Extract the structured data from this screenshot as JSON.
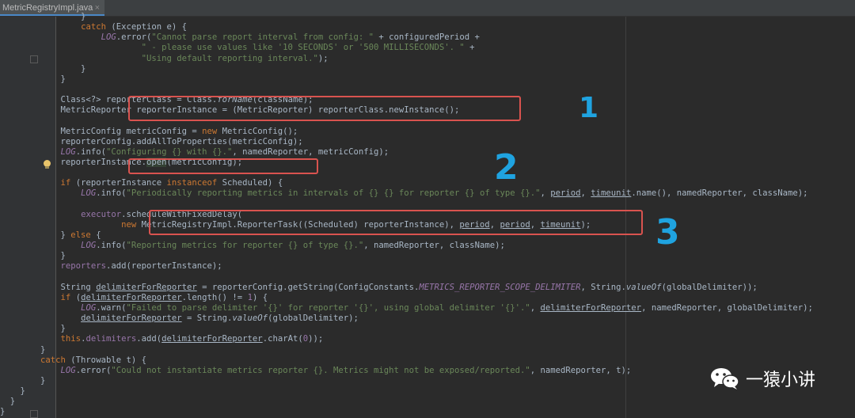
{
  "tab": {
    "filename": "MetricRegistryImpl.java",
    "close": "×"
  },
  "annotations": [
    "1",
    "2",
    "3"
  ],
  "watermark": {
    "text": "一猿小讲"
  },
  "colors": {
    "box": "#d9534f",
    "annotation": "#1fa3e0",
    "keyword": "#cc7832",
    "string": "#6a8759",
    "field": "#9876aa"
  },
  "code": [
    [
      [
        "                }",
        ""
      ]
    ],
    [
      [
        "                ",
        ""
      ],
      [
        "catch",
        "kw"
      ],
      [
        " (Exception e) {",
        ""
      ]
    ],
    [
      [
        "                    ",
        ""
      ],
      [
        "LOG",
        "log"
      ],
      [
        ".error(",
        ""
      ],
      [
        "\"Cannot parse report interval from config: \"",
        "str"
      ],
      [
        " + configuredPeriod +",
        ""
      ]
    ],
    [
      [
        "                            ",
        ""
      ],
      [
        "\" - please use values like '10 SECONDS' or '500 MILLISECONDS'. \"",
        "str"
      ],
      [
        " +",
        ""
      ]
    ],
    [
      [
        "                            ",
        ""
      ],
      [
        "\"Using default reporting interval.\"",
        "str"
      ],
      [
        ");",
        ""
      ]
    ],
    [
      [
        "                }",
        ""
      ]
    ],
    [
      [
        "            }",
        ""
      ]
    ],
    [
      [
        "",
        ""
      ]
    ],
    [
      [
        "            Class<?> reporterClass = Class.",
        ""
      ],
      [
        "forName",
        "itl"
      ],
      [
        "(className);",
        ""
      ]
    ],
    [
      [
        "            MetricReporter reporterInstance = (MetricReporter) reporterClass.newInstance();",
        ""
      ]
    ],
    [
      [
        "",
        ""
      ]
    ],
    [
      [
        "            MetricConfig metricConfig = ",
        ""
      ],
      [
        "new",
        "kw"
      ],
      [
        " MetricConfig();",
        ""
      ]
    ],
    [
      [
        "            reporterConfig.addAllToProperties(metricConfig);",
        ""
      ]
    ],
    [
      [
        "            ",
        ""
      ],
      [
        "LOG",
        "log"
      ],
      [
        ".info(",
        ""
      ],
      [
        "\"Configuring {} with {}.\"",
        "str"
      ],
      [
        ", namedReporter, metricConfig);",
        ""
      ]
    ],
    [
      [
        "            reporterInstance.",
        ""
      ],
      [
        "open",
        "hl"
      ],
      [
        "(metricConfig);",
        ""
      ]
    ],
    [
      [
        "",
        ""
      ]
    ],
    [
      [
        "            ",
        ""
      ],
      [
        "if",
        "kw"
      ],
      [
        " (reporterInstance ",
        ""
      ],
      [
        "instanceof",
        "kw"
      ],
      [
        " Scheduled) {",
        ""
      ]
    ],
    [
      [
        "                ",
        ""
      ],
      [
        "LOG",
        "log"
      ],
      [
        ".info(",
        ""
      ],
      [
        "\"Periodically reporting metrics in intervals of {} {} for reporter {} of type {}.\"",
        "str"
      ],
      [
        ", ",
        ""
      ],
      [
        "period",
        "ul"
      ],
      [
        ", ",
        ""
      ],
      [
        "timeunit",
        "ul"
      ],
      [
        ".name(), namedReporter, className);",
        ""
      ]
    ],
    [
      [
        "",
        ""
      ]
    ],
    [
      [
        "                ",
        ""
      ],
      [
        "executor",
        "fld"
      ],
      [
        ".scheduleWithFixedDelay(",
        ""
      ]
    ],
    [
      [
        "                        ",
        ""
      ],
      [
        "new",
        "kw"
      ],
      [
        " MetricRegistryImpl.ReporterTask((Scheduled) reporterInstance), ",
        ""
      ],
      [
        "period",
        "ul"
      ],
      [
        ", ",
        ""
      ],
      [
        "period",
        "ul"
      ],
      [
        ", ",
        ""
      ],
      [
        "timeunit",
        "ul"
      ],
      [
        ");",
        ""
      ]
    ],
    [
      [
        "            } ",
        ""
      ],
      [
        "else",
        "kw"
      ],
      [
        " {",
        ""
      ]
    ],
    [
      [
        "                ",
        ""
      ],
      [
        "LOG",
        "log"
      ],
      [
        ".info(",
        ""
      ],
      [
        "\"Reporting metrics for reporter {} of type {}.\"",
        "str"
      ],
      [
        ", namedReporter, className);",
        ""
      ]
    ],
    [
      [
        "            }",
        ""
      ]
    ],
    [
      [
        "            ",
        ""
      ],
      [
        "reporters",
        "fld"
      ],
      [
        ".add(reporterInstance);",
        ""
      ]
    ],
    [
      [
        "",
        ""
      ]
    ],
    [
      [
        "            String ",
        ""
      ],
      [
        "delimiterForReporter",
        "ul"
      ],
      [
        " = reporterConfig.getString(ConfigConstants.",
        ""
      ],
      [
        "METRICS_REPORTER_SCOPE_DELIMITER",
        "log"
      ],
      [
        ", String.",
        ""
      ],
      [
        "valueOf",
        "itl"
      ],
      [
        "(globalDelimiter));",
        ""
      ]
    ],
    [
      [
        "            ",
        ""
      ],
      [
        "if",
        "kw"
      ],
      [
        " (",
        ""
      ],
      [
        "delimiterForReporter",
        "ul"
      ],
      [
        ".length() != ",
        ""
      ],
      [
        "1",
        "fld"
      ],
      [
        ") {",
        ""
      ]
    ],
    [
      [
        "                ",
        ""
      ],
      [
        "LOG",
        "log"
      ],
      [
        ".warn(",
        ""
      ],
      [
        "\"Failed to parse delimiter '{}' for reporter '{}', using global delimiter '{}'.\"",
        "str"
      ],
      [
        ", ",
        ""
      ],
      [
        "delimiterForReporter",
        "ul"
      ],
      [
        ", namedReporter, globalDelimiter);",
        ""
      ]
    ],
    [
      [
        "                ",
        ""
      ],
      [
        "delimiterForReporter",
        "ul"
      ],
      [
        " = String.",
        ""
      ],
      [
        "valueOf",
        "itl"
      ],
      [
        "(globalDelimiter);",
        ""
      ]
    ],
    [
      [
        "            }",
        ""
      ]
    ],
    [
      [
        "            ",
        ""
      ],
      [
        "this",
        "kw"
      ],
      [
        ".",
        ""
      ],
      [
        "delimiters",
        "fld"
      ],
      [
        ".add(",
        ""
      ],
      [
        "delimiterForReporter",
        "ul"
      ],
      [
        ".charAt(",
        ""
      ],
      [
        "0",
        "fld"
      ],
      [
        "));",
        ""
      ]
    ],
    [
      [
        "        }",
        ""
      ]
    ],
    [
      [
        "        ",
        ""
      ],
      [
        "catch",
        "kw"
      ],
      [
        " (Throwable t) {",
        ""
      ]
    ],
    [
      [
        "            ",
        ""
      ],
      [
        "LOG",
        "log"
      ],
      [
        ".error(",
        ""
      ],
      [
        "\"Could not instantiate metrics reporter {}. Metrics might not be exposed/reported.\"",
        "str"
      ],
      [
        ", namedReporter, t);",
        ""
      ]
    ],
    [
      [
        "        }",
        ""
      ]
    ],
    [
      [
        "    }",
        ""
      ]
    ],
    [
      [
        "  }",
        ""
      ]
    ],
    [
      [
        "}",
        ""
      ]
    ]
  ]
}
